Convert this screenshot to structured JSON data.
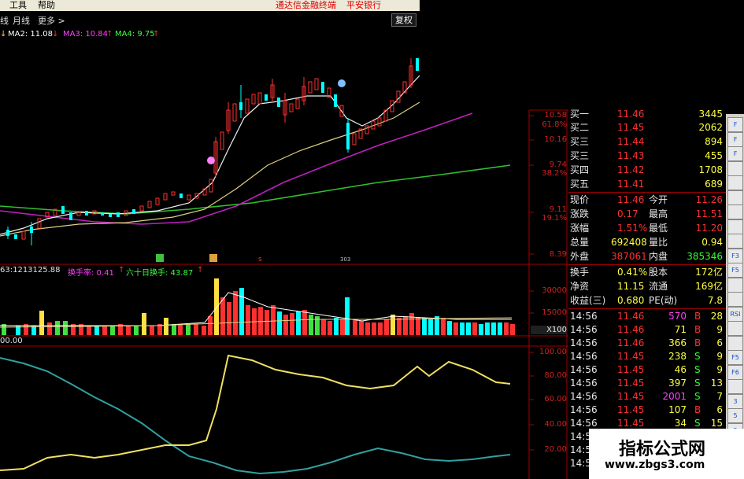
{
  "menu": {
    "items": [
      "工具",
      "帮助"
    ],
    "promo": [
      "通达信金融终端",
      "平安银行"
    ]
  },
  "tabs": {
    "items": [
      "线",
      "月线",
      "更多 >"
    ],
    "fuquan": "复权"
  },
  "ma_legend": [
    {
      "text": "MA2: 11.08",
      "color": "#ffffff"
    },
    {
      "text": "MA3: 10.84",
      "color": "#ff40ff"
    },
    {
      "text": "MA4: 9.75",
      "color": "#40ff40"
    }
  ],
  "price_axis": [
    "10.58",
    "61.8%",
    "10.16",
    "9.74",
    "38.2%",
    "9.11",
    "19.1%",
    "8.39"
  ],
  "vol_legend": [
    "63:1213125.88",
    "换手率: 0.41",
    "六十日换手: 43.87"
  ],
  "vol_axis": [
    "30000",
    "15000",
    "X100"
  ],
  "ind_legend": "00.00",
  "ind_axis": [
    "100.00",
    "80.00",
    "60.00",
    "40.00",
    "20.00"
  ],
  "quote": {
    "bids": [
      {
        "label": "买一",
        "price": "11.46",
        "vol": "3445"
      },
      {
        "label": "买二",
        "price": "11.45",
        "vol": "2062"
      },
      {
        "label": "买三",
        "price": "11.44",
        "vol": "894"
      },
      {
        "label": "买三",
        "price": "11.43",
        "vol": "455"
      },
      {
        "label": "买四",
        "price": "11.42",
        "vol": "1708"
      },
      {
        "label": "买五",
        "price": "11.41",
        "vol": "689"
      }
    ],
    "stats": [
      {
        "l1": "现价",
        "v1": "11.46",
        "l2": "今开",
        "v2": "11.26"
      },
      {
        "l1": "涨跌",
        "v1": "0.17",
        "l2": "最高",
        "v2": "11.51"
      },
      {
        "l1": "涨幅",
        "v1": "1.51%",
        "l2": "最低",
        "v2": "11.20"
      },
      {
        "l1": "总量",
        "v1": "692408",
        "l2": "量比",
        "v2": "0.94"
      },
      {
        "l1": "外盘",
        "v1": "387061",
        "l2": "内盘",
        "v2": "385346"
      }
    ],
    "turnover": [
      {
        "l1": "换手",
        "v1": "0.41%",
        "l2": "股本",
        "v2": "172亿"
      },
      {
        "l1": "净资",
        "v1": "11.15",
        "l2": "流通",
        "v2": "169亿"
      },
      {
        "l1": "收益(三)",
        "v1": "0.680",
        "l2": "PE(动)",
        "v2": "7.8"
      }
    ],
    "ticks": [
      {
        "time": "14:56",
        "price": "11.46",
        "vol": "570",
        "side": "B",
        "n": "28"
      },
      {
        "time": "14:56",
        "price": "11.46",
        "vol": "71",
        "side": "B",
        "n": "9"
      },
      {
        "time": "14:56",
        "price": "11.46",
        "vol": "366",
        "side": "B",
        "n": "6"
      },
      {
        "time": "14:56",
        "price": "11.45",
        "vol": "238",
        "side": "S",
        "n": "9"
      },
      {
        "time": "14:56",
        "price": "11.45",
        "vol": "46",
        "side": "S",
        "n": "9"
      },
      {
        "time": "14:56",
        "price": "11.45",
        "vol": "397",
        "side": "S",
        "n": "13"
      },
      {
        "time": "14:56",
        "price": "11.45",
        "vol": "2001",
        "side": "S",
        "n": "7"
      },
      {
        "time": "14:56",
        "price": "11.45",
        "vol": "107",
        "side": "B",
        "n": "6"
      },
      {
        "time": "14:56",
        "price": "11.45",
        "vol": "34",
        "side": "S",
        "n": "15"
      },
      {
        "time": "14:5",
        "price": "",
        "vol": "",
        "side": "",
        "n": ""
      },
      {
        "time": "14:5",
        "price": "",
        "vol": "",
        "side": "",
        "n": ""
      },
      {
        "time": "14:5",
        "price": "",
        "vol": "",
        "side": "",
        "n": ""
      }
    ]
  },
  "toolbar": [
    "F",
    "F",
    "F",
    "",
    "",
    "",
    "",
    "",
    "",
    "F3",
    "F5",
    "",
    "",
    "RSI",
    "",
    "",
    "F5",
    "F6",
    "",
    "3",
    "5",
    "5"
  ],
  "watermark": {
    "title": "指标公式网",
    "url": "www.zbgs3.com"
  }
}
